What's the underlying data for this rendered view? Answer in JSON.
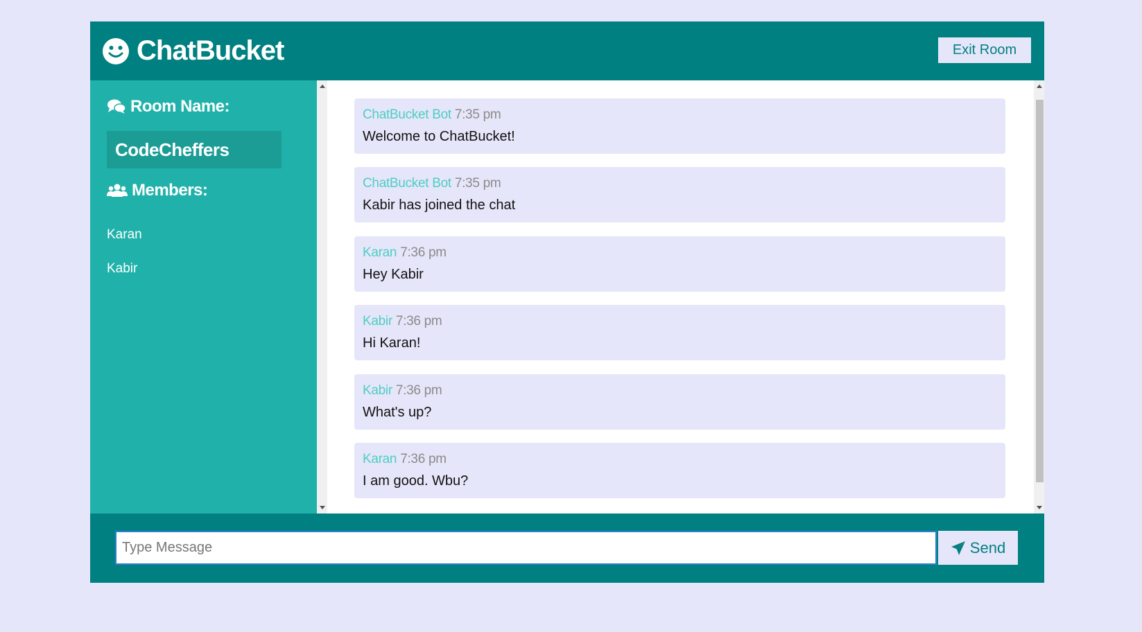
{
  "header": {
    "app_name": "ChatBucket",
    "logo_icon": "smile-icon",
    "exit_label": "Exit Room"
  },
  "sidebar": {
    "room_heading": "Room Name:",
    "room_icon": "comments-icon",
    "room_name": "CodeCheffers",
    "members_heading": "Members:",
    "members_icon": "users-icon",
    "members": [
      "Karan",
      "Kabir"
    ]
  },
  "messages": [
    {
      "author": "ChatBucket Bot",
      "time": "7:35 pm",
      "text": "Welcome to ChatBucket!"
    },
    {
      "author": "ChatBucket Bot",
      "time": "7:35 pm",
      "text": "Kabir has joined the chat"
    },
    {
      "author": "Karan",
      "time": "7:36 pm",
      "text": "Hey Kabir"
    },
    {
      "author": "Kabir",
      "time": "7:36 pm",
      "text": "Hi Karan!"
    },
    {
      "author": "Kabir",
      "time": "7:36 pm",
      "text": "What's up?"
    },
    {
      "author": "Karan",
      "time": "7:36 pm",
      "text": "I am good. Wbu?"
    }
  ],
  "composer": {
    "placeholder": "Type Message",
    "value": "",
    "send_label": "Send",
    "send_icon": "paper-plane-icon"
  },
  "colors": {
    "header": "#008080",
    "sidebar": "#20b2aa",
    "background": "#e6e6fa",
    "author": "#4ecdc4"
  }
}
